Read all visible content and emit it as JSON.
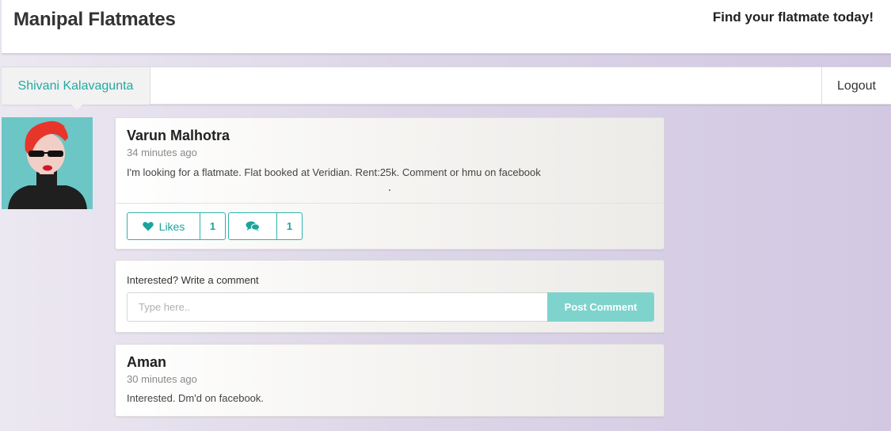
{
  "header": {
    "brand": "Manipal Flatmates",
    "tagline": "Find your flatmate today!"
  },
  "nav": {
    "user_name": "Shivani Kalavagunta",
    "logout_label": "Logout"
  },
  "post": {
    "author": "Varun Malhotra",
    "time_ago": "34 minutes ago",
    "text": "I'm looking for a flatmate. Flat booked at Veridian. Rent:25k. Comment or hmu on facebook",
    "likes_label": "Likes",
    "likes_count": "1",
    "comments_count": "1"
  },
  "comment_box": {
    "label": "Interested? Write a comment",
    "placeholder": "Type here..",
    "button_label": "Post Comment"
  },
  "comments": [
    {
      "author": "Aman",
      "time_ago": "30 minutes ago",
      "text": "Interested. Dm'd on facebook."
    }
  ],
  "colors": {
    "accent": "#22aaa2",
    "button_bg": "#7fd3cd",
    "avatar_bg": "#6cc6c6"
  },
  "icons": {
    "likes": "heart-icon",
    "comments": "comments-icon"
  }
}
